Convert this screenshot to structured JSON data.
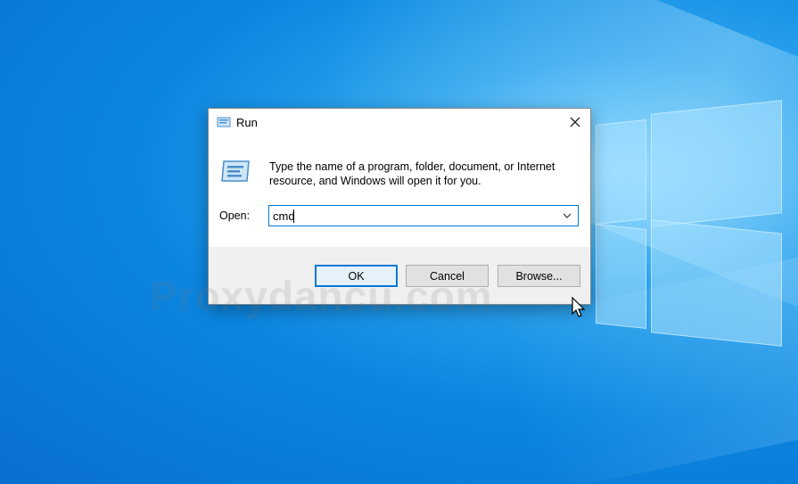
{
  "dialog": {
    "title": "Run",
    "description": "Type the name of a program, folder, document, or Internet resource, and Windows will open it for you.",
    "open_label": "Open:",
    "open_value": "cmd",
    "buttons": {
      "ok": "OK",
      "cancel": "Cancel",
      "browse": "Browse..."
    },
    "icons": {
      "title": "run-icon",
      "large": "run-icon",
      "close": "close-icon",
      "dropdown": "chevron-down-icon"
    }
  },
  "watermark": "Proxydancu.com",
  "colors": {
    "accent": "#0078d7",
    "desktop": "#0b86e0",
    "footer": "#f0f0f0"
  }
}
